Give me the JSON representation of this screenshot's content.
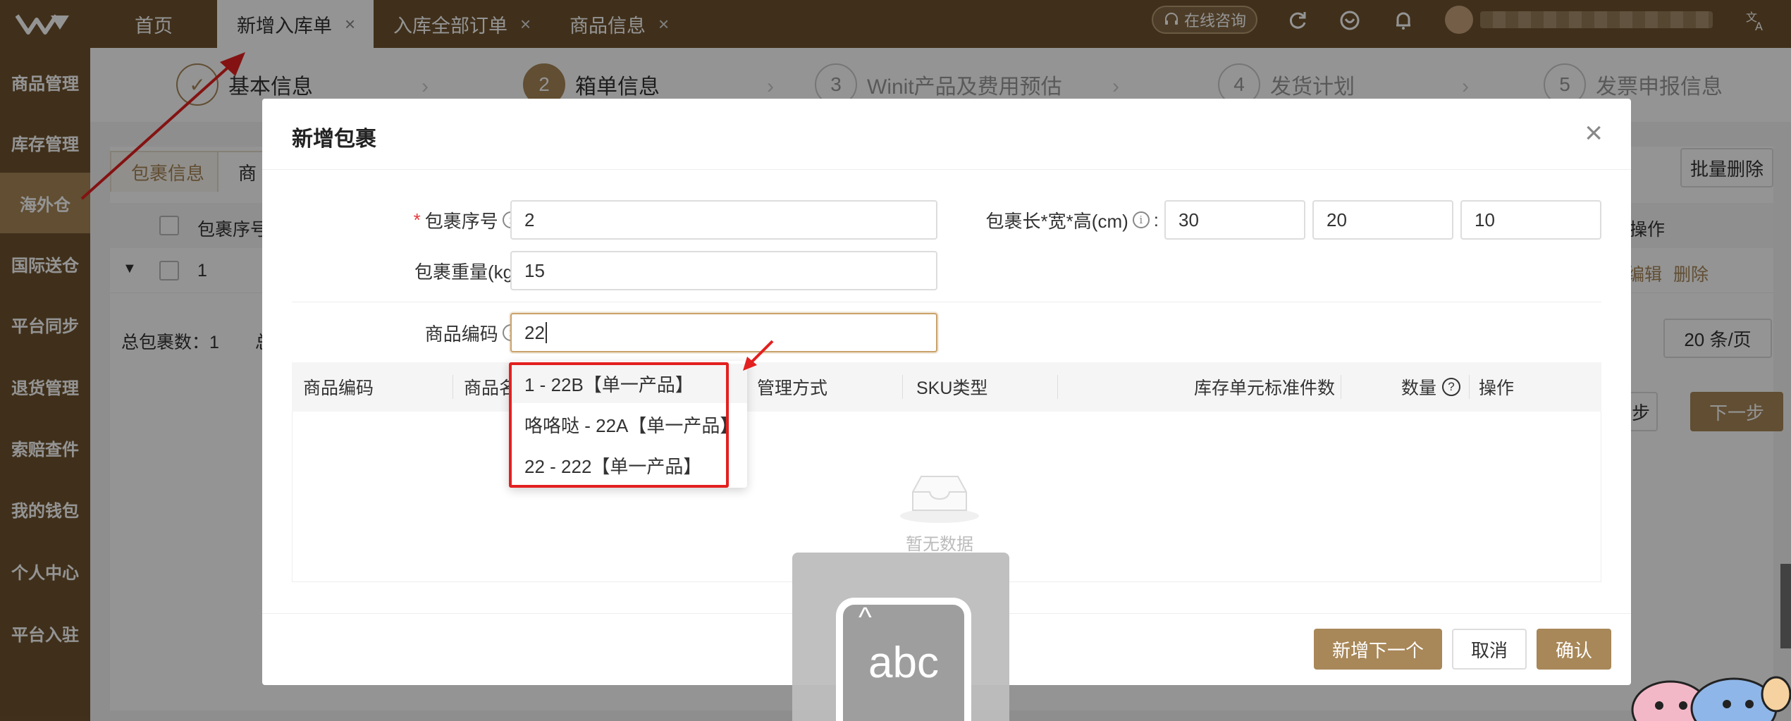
{
  "topbar": {
    "tabs": [
      {
        "label": "首页",
        "closable": false,
        "active": false
      },
      {
        "label": "新增入库单",
        "closable": true,
        "active": true
      },
      {
        "label": "入库全部订单",
        "closable": true,
        "active": false
      },
      {
        "label": "商品信息",
        "closable": true,
        "active": false
      }
    ],
    "close_glyph": "×",
    "consult_label": "在线咨询",
    "icons": [
      "refresh-icon",
      "heart-shield-icon",
      "bell-icon",
      "translate-icon"
    ]
  },
  "sidebar": {
    "items": [
      "商品管理",
      "库存管理",
      "海外仓",
      "国际送仓",
      "平台同步",
      "退货管理",
      "索赔查件",
      "我的钱包",
      "个人中心",
      "平台入驻"
    ],
    "active_index": 2
  },
  "steps": [
    {
      "number": "✓",
      "label": "基本信息",
      "state": "done"
    },
    {
      "number": "2",
      "label": "箱单信息",
      "state": "current"
    },
    {
      "number": "3",
      "label": "Winit产品及费用预估",
      "state": "todo"
    },
    {
      "number": "4",
      "label": "发货计划",
      "state": "todo"
    },
    {
      "number": "5",
      "label": "发票申报信息",
      "state": "todo"
    }
  ],
  "background": {
    "tabs": [
      "包裹信息",
      "商"
    ],
    "columns": [
      "包裹序号",
      "操作"
    ],
    "row": {
      "index": "1",
      "edit": "编辑",
      "delete": "删除"
    },
    "total_label": "总包裹数：",
    "total_value": "1",
    "total_cut": "总",
    "batch_delete": "批量删除",
    "page_size": "20 条/页",
    "prev": "一步",
    "next": "下一步"
  },
  "modal": {
    "title": "新增包裹",
    "fields": {
      "package_no_label": "包裹序号",
      "package_no_value": "2",
      "weight_label": "包裹重量(kg)",
      "weight_value": "15",
      "dims_label": "包裹长*宽*高(cm)",
      "length": "30",
      "width": "20",
      "height": "10",
      "sku_label": "商品编码",
      "sku_value": "22"
    },
    "colon": ":",
    "table_columns": [
      "商品编码",
      "商品名",
      "管理方式",
      "SKU类型",
      "库存单元标准件数",
      "数量",
      "操作"
    ],
    "empty_text": "暂无数据",
    "buttons": {
      "add_next": "新增下一个",
      "cancel": "取消",
      "confirm": "确认"
    }
  },
  "dropdown": {
    "options": [
      "1 - 22B【单一产品】",
      "咯咯哒 - 22A【单一产品】",
      "22 - 222【单一产品】"
    ]
  },
  "keyboard_overlay": {
    "text": "abc"
  },
  "colors": {
    "brand": "#6e5330",
    "accent": "#a88758",
    "annotation": "#e32020"
  }
}
